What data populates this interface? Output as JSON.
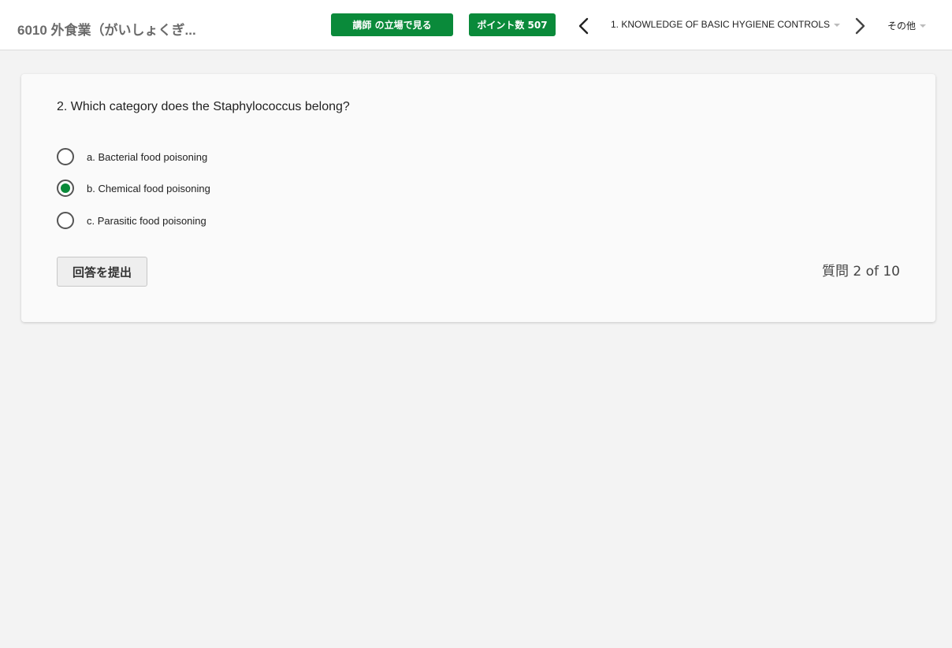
{
  "header": {
    "course_title": "6010 外食業（がいしょくぎ...",
    "instructor_view_label": "講師 の立場で見る",
    "points_label": "ポイント数 507",
    "lesson_title": "1. KNOWLEDGE OF BASIC HYGIENE CONTROLS",
    "other_menu_label": "その他",
    "icons": {
      "prev": "chevron-left-icon",
      "next": "chevron-right-icon",
      "dropdown": "caret-down-icon"
    }
  },
  "quiz": {
    "question": "2. Which category does the Staphylococcus belong?",
    "options": [
      {
        "label": "a. Bacterial food poisoning",
        "selected": false
      },
      {
        "label": "b. Chemical food poisoning",
        "selected": true
      },
      {
        "label": "c. Parasitic food poisoning",
        "selected": false
      }
    ],
    "submit_label": "回答を提出",
    "progress_text": "質問 2 of 10"
  },
  "colors": {
    "accent": "#0a8a3a",
    "background": "#f3f3f3",
    "card": "#fafafa"
  }
}
